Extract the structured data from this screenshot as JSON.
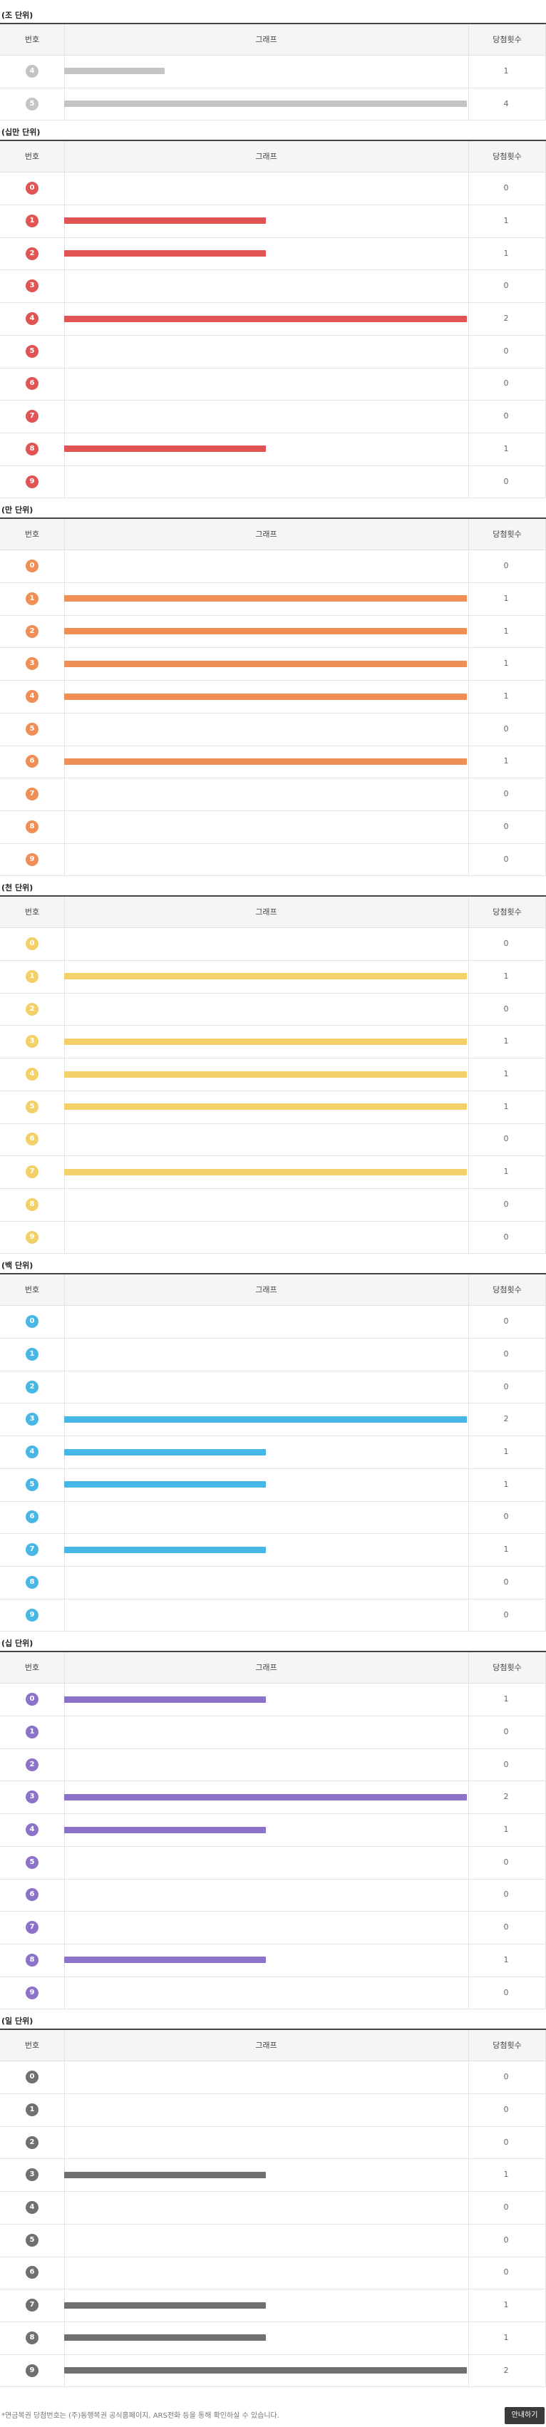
{
  "header": {
    "number": "번호",
    "graph": "그래프",
    "count": "당첨횟수"
  },
  "chart_data": {
    "type": "bar",
    "orientation": "horizontal",
    "groups": [
      {
        "title": "(조 단위)",
        "color": "#c4c4c4",
        "max": 4,
        "rows": [
          {
            "n": "4",
            "v": 1
          },
          {
            "n": "5",
            "v": 4
          }
        ]
      },
      {
        "title": "(십만 단위)",
        "color": "#e05454",
        "max": 2,
        "rows": [
          {
            "n": "0",
            "v": 0
          },
          {
            "n": "1",
            "v": 1
          },
          {
            "n": "2",
            "v": 1
          },
          {
            "n": "3",
            "v": 0
          },
          {
            "n": "4",
            "v": 2
          },
          {
            "n": "5",
            "v": 0
          },
          {
            "n": "6",
            "v": 0
          },
          {
            "n": "7",
            "v": 0
          },
          {
            "n": "8",
            "v": 1
          },
          {
            "n": "9",
            "v": 0
          }
        ]
      },
      {
        "title": "(만 단위)",
        "color": "#ef8f55",
        "max": 1,
        "rows": [
          {
            "n": "0",
            "v": 0
          },
          {
            "n": "1",
            "v": 1
          },
          {
            "n": "2",
            "v": 1
          },
          {
            "n": "3",
            "v": 1
          },
          {
            "n": "4",
            "v": 1
          },
          {
            "n": "5",
            "v": 0
          },
          {
            "n": "6",
            "v": 1
          },
          {
            "n": "7",
            "v": 0
          },
          {
            "n": "8",
            "v": 0
          },
          {
            "n": "9",
            "v": 0
          }
        ]
      },
      {
        "title": "(천 단위)",
        "color": "#f3d168",
        "max": 1,
        "rows": [
          {
            "n": "0",
            "v": 0
          },
          {
            "n": "1",
            "v": 1
          },
          {
            "n": "2",
            "v": 0
          },
          {
            "n": "3",
            "v": 1
          },
          {
            "n": "4",
            "v": 1
          },
          {
            "n": "5",
            "v": 1
          },
          {
            "n": "6",
            "v": 0
          },
          {
            "n": "7",
            "v": 1
          },
          {
            "n": "8",
            "v": 0
          },
          {
            "n": "9",
            "v": 0
          }
        ]
      },
      {
        "title": "(백 단위)",
        "color": "#49b7e6",
        "max": 2,
        "rows": [
          {
            "n": "0",
            "v": 0
          },
          {
            "n": "1",
            "v": 0
          },
          {
            "n": "2",
            "v": 0
          },
          {
            "n": "3",
            "v": 2
          },
          {
            "n": "4",
            "v": 1
          },
          {
            "n": "5",
            "v": 1
          },
          {
            "n": "6",
            "v": 0
          },
          {
            "n": "7",
            "v": 1
          },
          {
            "n": "8",
            "v": 0
          },
          {
            "n": "9",
            "v": 0
          }
        ]
      },
      {
        "title": "(십 단위)",
        "color": "#8c72c8",
        "max": 2,
        "rows": [
          {
            "n": "0",
            "v": 1
          },
          {
            "n": "1",
            "v": 0
          },
          {
            "n": "2",
            "v": 0
          },
          {
            "n": "3",
            "v": 2
          },
          {
            "n": "4",
            "v": 1
          },
          {
            "n": "5",
            "v": 0
          },
          {
            "n": "6",
            "v": 0
          },
          {
            "n": "7",
            "v": 0
          },
          {
            "n": "8",
            "v": 1
          },
          {
            "n": "9",
            "v": 0
          }
        ]
      },
      {
        "title": "(일 단위)",
        "color": "#707070",
        "max": 2,
        "rows": [
          {
            "n": "0",
            "v": 0
          },
          {
            "n": "1",
            "v": 0
          },
          {
            "n": "2",
            "v": 0
          },
          {
            "n": "3",
            "v": 1
          },
          {
            "n": "4",
            "v": 0
          },
          {
            "n": "5",
            "v": 0
          },
          {
            "n": "6",
            "v": 0
          },
          {
            "n": "7",
            "v": 1
          },
          {
            "n": "8",
            "v": 1
          },
          {
            "n": "9",
            "v": 2
          }
        ]
      }
    ]
  },
  "footer": {
    "note": "*연금복권 당첨번호는 (주)동행복권 공식홈페이지, ARS전화 등을 통해 확인하실 수 있습니다.",
    "guide_button": "안내하기"
  }
}
